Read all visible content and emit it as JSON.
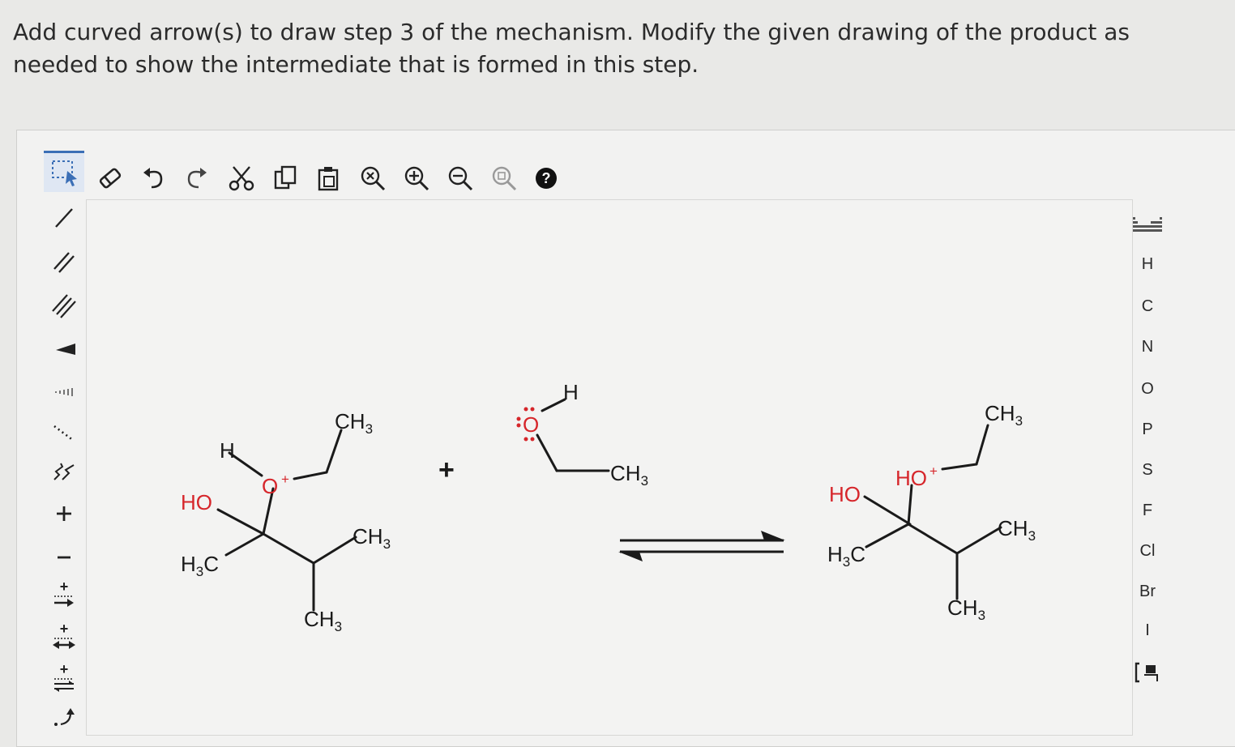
{
  "question": {
    "text": "Add curved arrow(s) to draw step 3 of the mechanism. Modify the given drawing of the product as needed to show the intermediate that is formed in this step."
  },
  "toolbar": {
    "items": [
      {
        "name": "select-tool",
        "icon": "lasso-select-icon"
      },
      {
        "name": "erase-tool",
        "icon": "eraser-icon"
      },
      {
        "name": "undo",
        "icon": "undo-icon"
      },
      {
        "name": "redo",
        "icon": "redo-icon"
      },
      {
        "name": "cut",
        "icon": "scissors-icon"
      },
      {
        "name": "copy",
        "icon": "copy-icon"
      },
      {
        "name": "paste",
        "icon": "paste-icon"
      },
      {
        "name": "zoom-reset",
        "icon": "zoom-reset-icon"
      },
      {
        "name": "zoom-in",
        "icon": "zoom-in-icon"
      },
      {
        "name": "zoom-out",
        "icon": "zoom-out-icon"
      },
      {
        "name": "zoom-fit",
        "icon": "zoom-fit-icon"
      },
      {
        "name": "help",
        "icon": "help-icon"
      }
    ]
  },
  "left_tools": {
    "items": [
      {
        "name": "single-bond",
        "icon": "single-bond-icon"
      },
      {
        "name": "double-bond",
        "icon": "double-bond-icon"
      },
      {
        "name": "triple-bond",
        "icon": "triple-bond-icon"
      },
      {
        "name": "wedge-bond",
        "icon": "wedge-bond-icon"
      },
      {
        "name": "hash-bond",
        "icon": "hash-bond-icon"
      },
      {
        "name": "dashed-bond",
        "icon": "dashed-bond-icon"
      },
      {
        "name": "wavy-bond",
        "icon": "wavy-bond-icon"
      },
      {
        "name": "positive-charge",
        "icon": "plus-icon",
        "label": "+"
      },
      {
        "name": "negative-charge",
        "icon": "minus-icon",
        "label": "−"
      },
      {
        "name": "reaction-arrow",
        "icon": "reaction-arrow-icon"
      },
      {
        "name": "resonance-arrow",
        "icon": "resonance-arrow-icon"
      },
      {
        "name": "equilibrium-arrow",
        "icon": "equilibrium-arrow-icon"
      },
      {
        "name": "curved-arrow",
        "icon": "curved-arrow-icon"
      }
    ]
  },
  "elements": {
    "items": [
      "H",
      "C",
      "N",
      "O",
      "P",
      "S",
      "F",
      "Cl",
      "Br",
      "I"
    ],
    "table_icon": "periodic-table-icon",
    "bracket_icon": "bracket-icon"
  },
  "molecules": {
    "reactant": {
      "h": "H",
      "o_plus": "O",
      "o_charge": "+",
      "ch3_top": "CH",
      "ho": "HO",
      "h3c_h": "H",
      "h3c_c": "C",
      "ch3_right": "CH",
      "ch3_bottom": "CH",
      "sub3": "3"
    },
    "plus_sign": "+",
    "reagent": {
      "o": "O",
      "h": "H",
      "ch3": "CH",
      "sub3": "3"
    },
    "product": {
      "ho_left": "HO",
      "ho_plus": "HO",
      "charge": "+",
      "ch3_top": "CH",
      "h3c_h": "H",
      "h3c_c": "C",
      "ch3_right": "CH",
      "ch3_bottom": "CH",
      "sub3": "3"
    }
  },
  "colors": {
    "oxygen": "#d6262b",
    "bond": "#1a1a1a",
    "accent": "#3b6fb6"
  }
}
